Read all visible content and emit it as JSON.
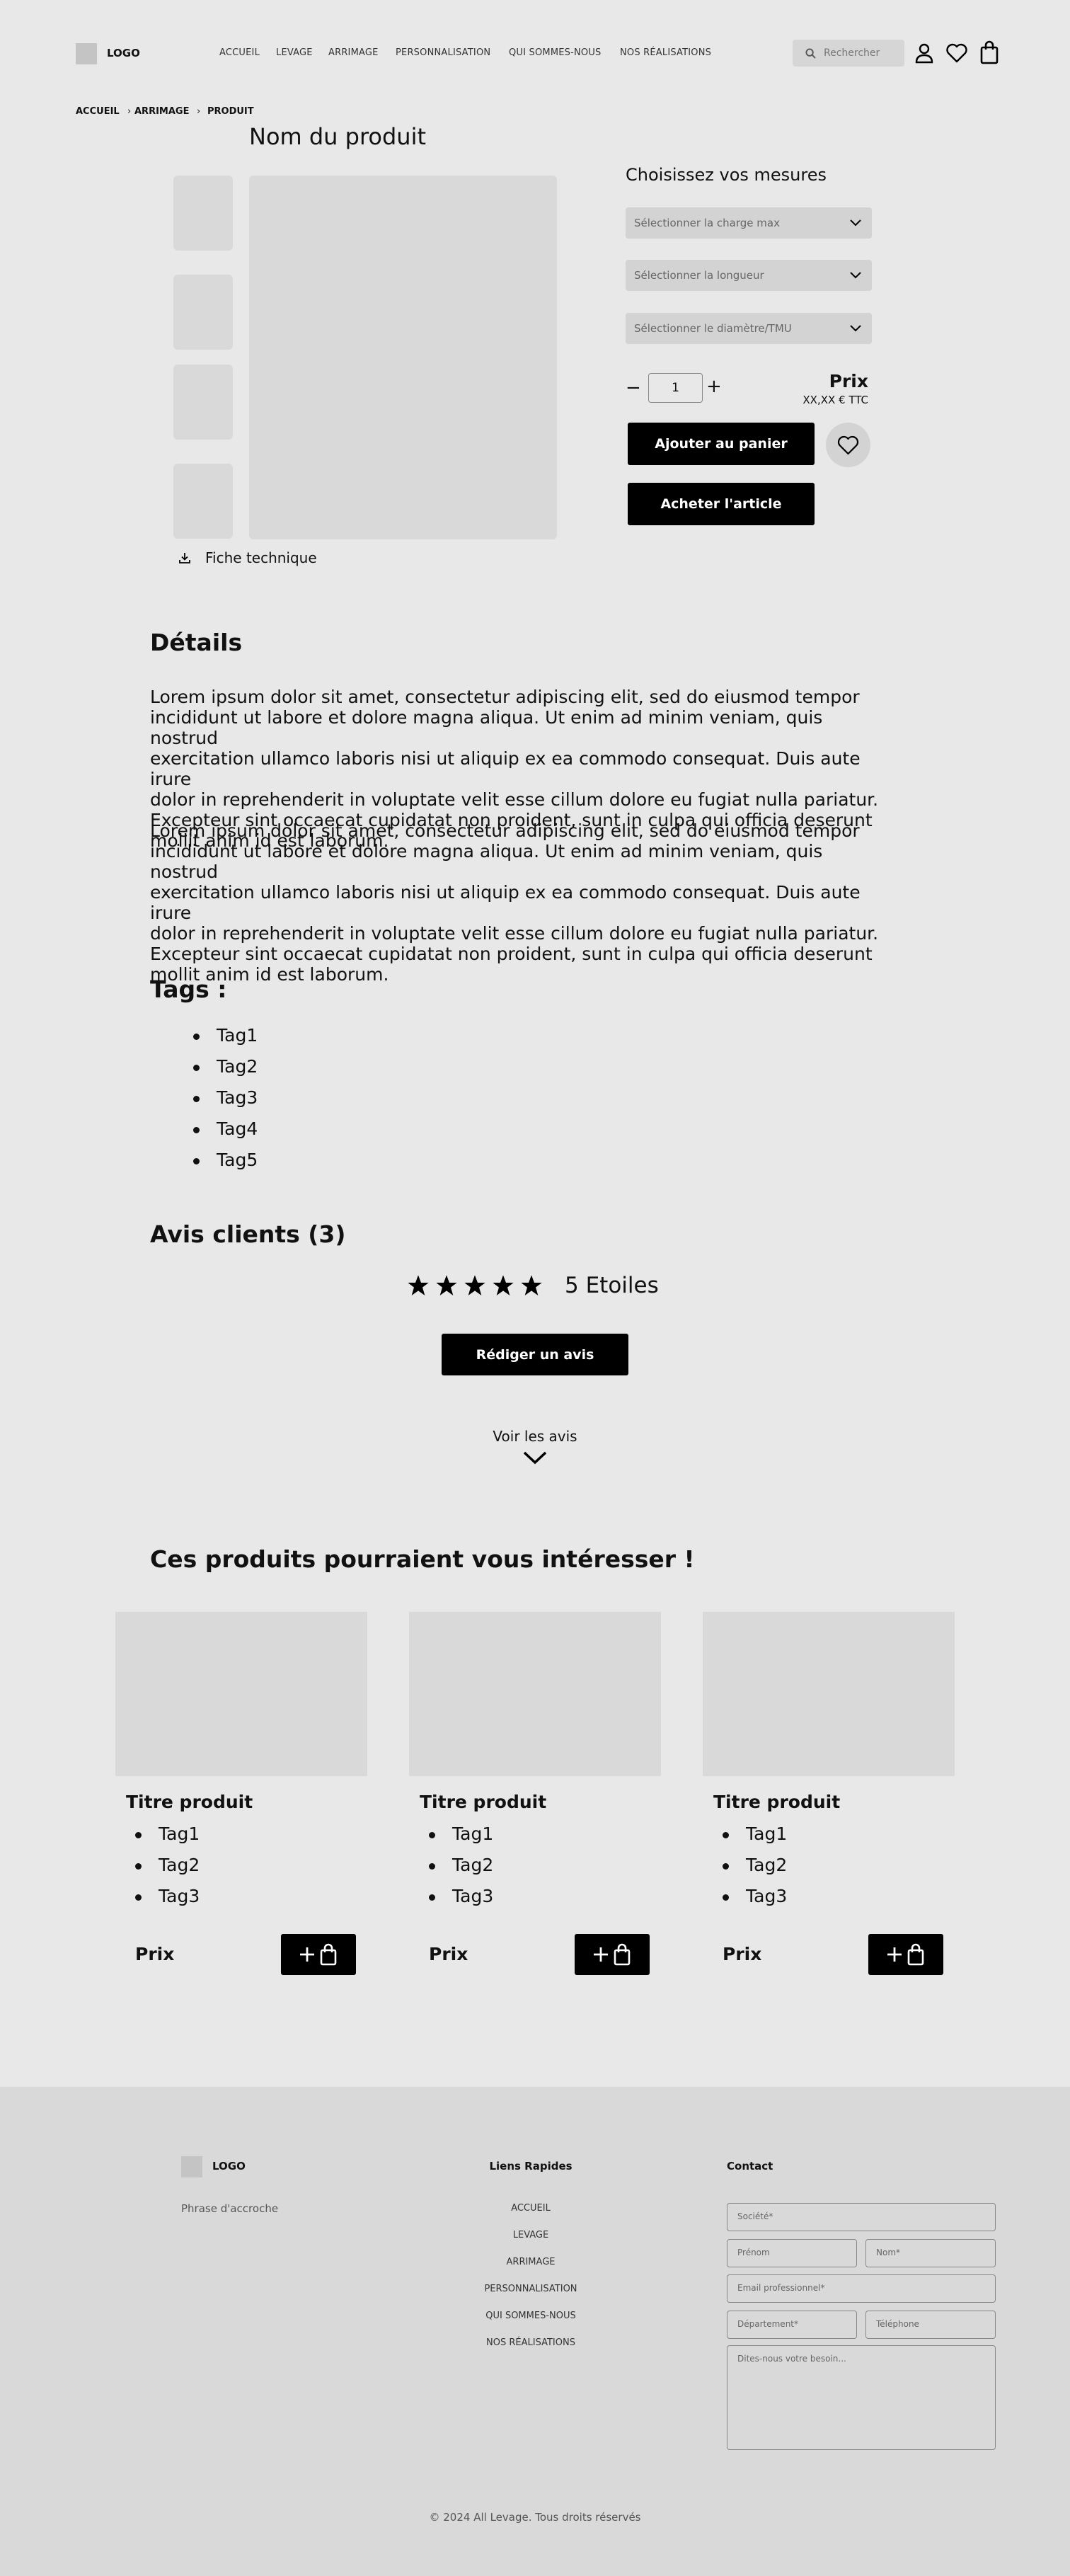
{
  "header": {
    "logo": "LOGO",
    "nav": [
      "ACCUEIL",
      "LEVAGE",
      "ARRIMAGE",
      "PERSONNALISATION",
      "QUI SOMMES-NOUS",
      "NOS RÉALISATIONS"
    ],
    "search_placeholder": "Rechercher"
  },
  "breadcrumb": [
    "ACCUEIL",
    "ARRIMAGE",
    "PRODUIT"
  ],
  "product": {
    "title": "Nom du produit",
    "datasheet": "Fiche technique",
    "measures_title": "Choisissez vos mesures",
    "selects": [
      "Sélectionner la charge max",
      "Sélectionner la longueur",
      "Sélectionner le diamètre/TMU"
    ],
    "quantity": "1",
    "price_label": "Prix",
    "price_value": "XX,XX € TTC",
    "add_to_cart": "Ajouter au panier",
    "buy": "Acheter l'article"
  },
  "details": {
    "title": "Détails",
    "p1": [
      "Lorem ipsum dolor sit amet, consectetur adipiscing elit, sed do eiusmod tempor",
      "incididunt ut labore et dolore magna aliqua. Ut enim ad minim veniam, quis nostrud",
      "exercitation ullamco laboris nisi ut aliquip ex ea commodo consequat. Duis aute irure",
      "dolor in reprehenderit in voluptate velit esse cillum dolore eu fugiat nulla pariatur.",
      "Excepteur sint occaecat cupidatat non proident, sunt in culpa qui officia deserunt",
      "mollit anim id est laborum."
    ],
    "p2": [
      "Lorem ipsum dolor sit amet, consectetur adipiscing elit, sed do eiusmod tempor",
      "incididunt ut labore et dolore magna aliqua. Ut enim ad minim veniam, quis nostrud",
      "exercitation ullamco laboris nisi ut aliquip ex ea commodo consequat. Duis aute irure",
      "dolor in reprehenderit in voluptate velit esse cillum dolore eu fugiat nulla pariatur.",
      "Excepteur sint occaecat cupidatat non proident, sunt in culpa qui officia deserunt",
      "mollit anim id est laborum."
    ]
  },
  "tags": {
    "title": "Tags :",
    "items": [
      "Tag1",
      "Tag2",
      "Tag3",
      "Tag4",
      "Tag5"
    ]
  },
  "reviews": {
    "title": "Avis clients (3)",
    "rating": 5,
    "rating_text": "5 Etoiles",
    "write_button": "Rédiger un avis",
    "see_reviews": "Voir les avis"
  },
  "related": {
    "title": "Ces produits pourraient vous intéresser !",
    "cards": [
      {
        "title": "Titre produit",
        "tags": [
          "Tag1",
          "Tag2",
          "Tag3"
        ],
        "price": "Prix"
      },
      {
        "title": "Titre produit",
        "tags": [
          "Tag1",
          "Tag2",
          "Tag3"
        ],
        "price": "Prix"
      },
      {
        "title": "Titre produit",
        "tags": [
          "Tag1",
          "Tag2",
          "Tag3"
        ],
        "price": "Prix"
      }
    ]
  },
  "footer": {
    "logo": "LOGO",
    "tagline": "Phrase d'accroche",
    "links_title": "Liens Rapides",
    "links": [
      "ACCUEIL",
      "LEVAGE",
      "ARRIMAGE",
      "PERSONNALISATION",
      "QUI SOMMES-NOUS",
      "NOS RÉALISATIONS"
    ],
    "contact_title": "Contact",
    "fields": {
      "company": "Société*",
      "firstname": "Prénom",
      "lastname": "Nom*",
      "email": "Email professionnel*",
      "department": "Département*",
      "phone": "Téléphone",
      "message": "Dites-nous votre besoin..."
    },
    "copyright": "© 2024 All Levage. Tous droits réservés"
  }
}
